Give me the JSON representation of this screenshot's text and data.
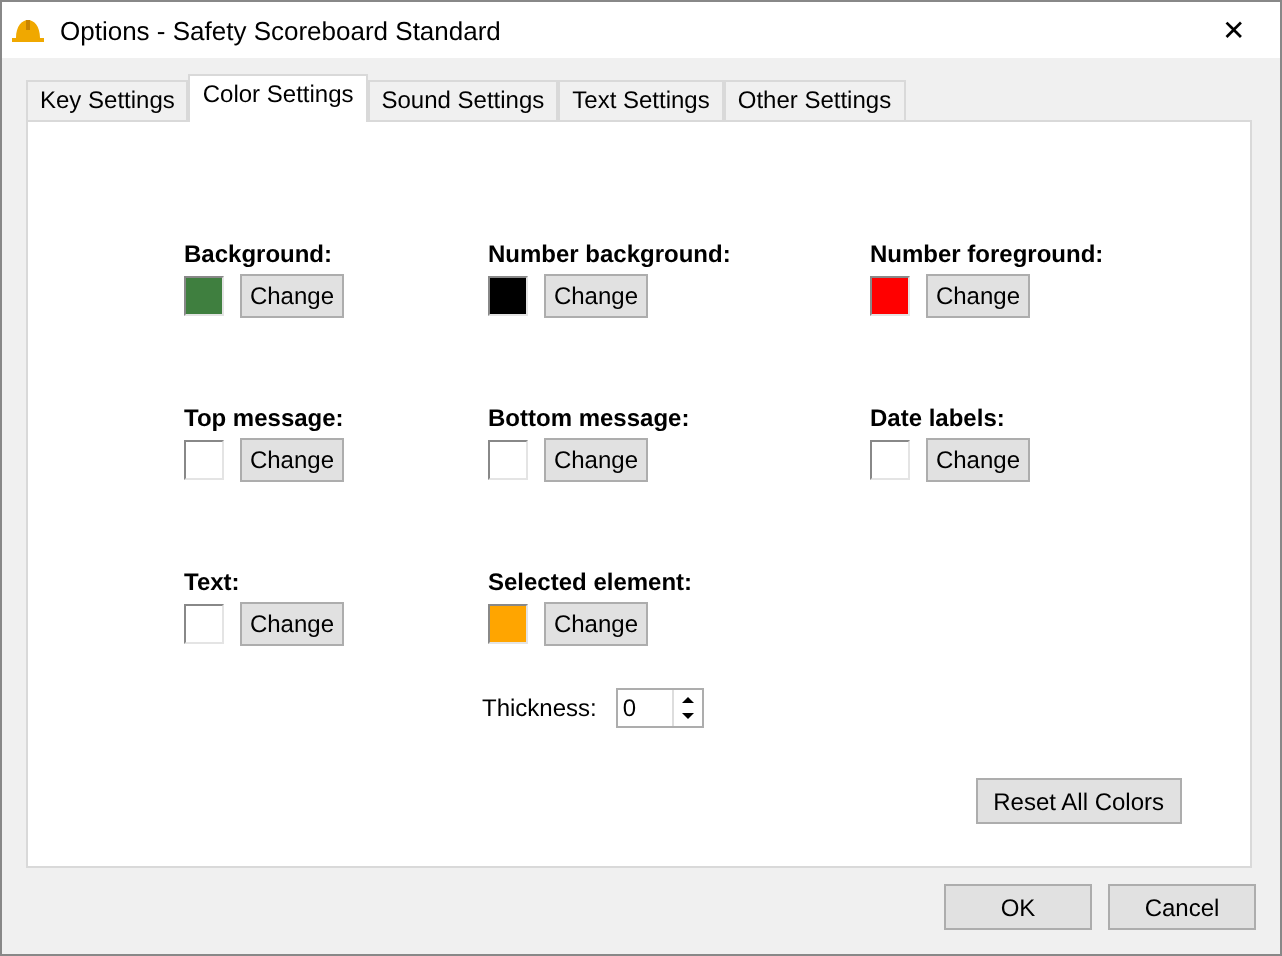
{
  "window": {
    "title": "Options - Safety Scoreboard Standard",
    "close": "✕"
  },
  "tabs": [
    {
      "label": "Key Settings",
      "selected": false
    },
    {
      "label": "Color Settings",
      "selected": true
    },
    {
      "label": "Sound Settings",
      "selected": false
    },
    {
      "label": "Text Settings",
      "selected": false
    },
    {
      "label": "Other Settings",
      "selected": false
    }
  ],
  "color_options": [
    {
      "label": "Background:",
      "color": "#3f7f3f",
      "button": "Change"
    },
    {
      "label": "Number background:",
      "color": "#000000",
      "button": "Change"
    },
    {
      "label": "Number foreground:",
      "color": "#ff0000",
      "button": "Change"
    },
    {
      "label": "Top message:",
      "color": "#ffffff",
      "button": "Change"
    },
    {
      "label": "Bottom message:",
      "color": "#ffffff",
      "button": "Change"
    },
    {
      "label": "Date labels:",
      "color": "#ffffff",
      "button": "Change"
    },
    {
      "label": "Text:",
      "color": "#ffffff",
      "button": "Change"
    },
    {
      "label": "Selected element:",
      "color": "#ffa500",
      "button": "Change"
    }
  ],
  "thickness": {
    "label": "Thickness:",
    "value": "0"
  },
  "reset_button": "Reset All Colors",
  "buttons": [
    "OK",
    "Cancel"
  ]
}
